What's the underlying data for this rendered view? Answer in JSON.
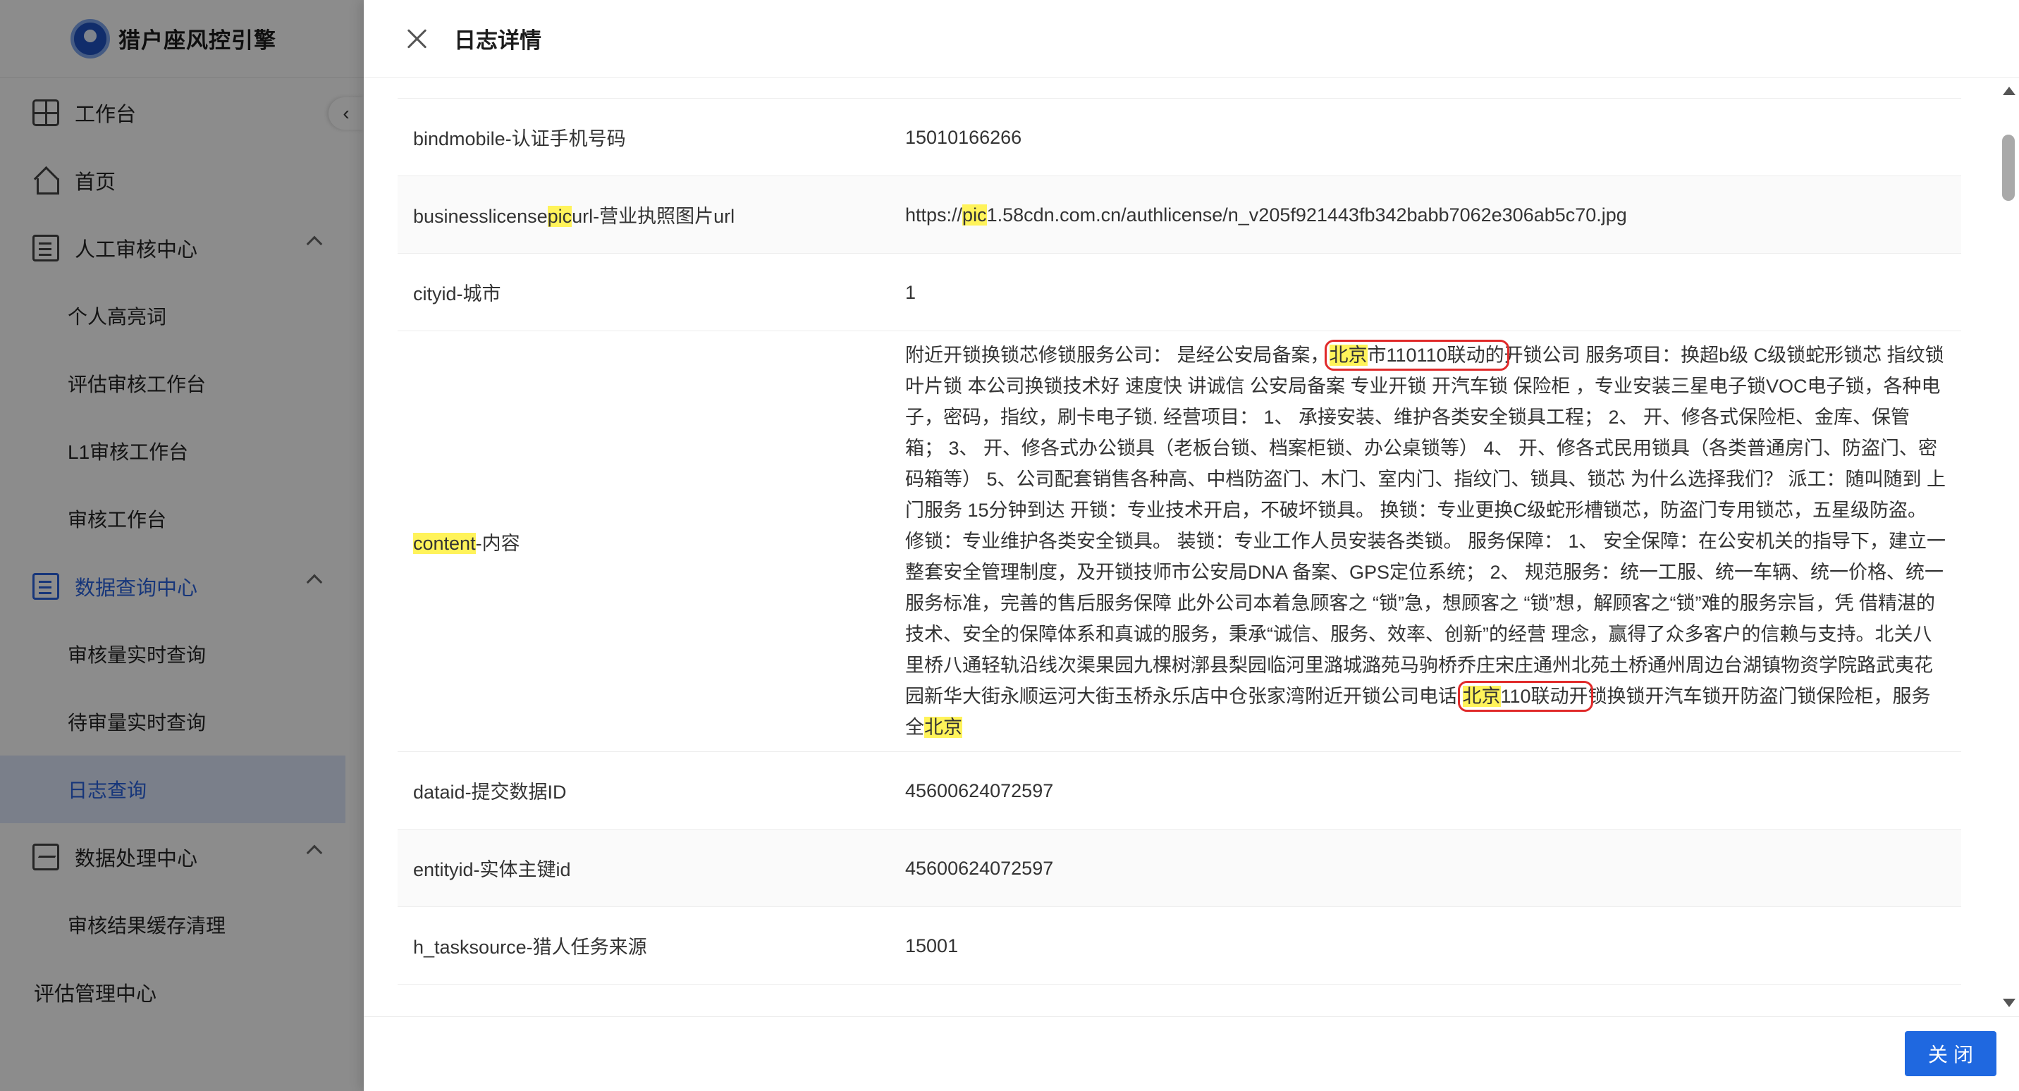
{
  "app": {
    "brand_title": "猎户座风控引擎"
  },
  "sidebar": {
    "collapse_glyph": "‹",
    "items": [
      {
        "label": "工作台",
        "icon": "dashboard-icon"
      },
      {
        "label": "首页",
        "icon": "home-icon"
      },
      {
        "label": "人工审核中心",
        "icon": "review-icon",
        "expanded": true,
        "children": [
          "个人高亮词",
          "评估审核工作台",
          "L1审核工作台",
          "审核工作台"
        ]
      },
      {
        "label": "数据查询中心",
        "icon": "query-icon",
        "expanded": true,
        "children": [
          "审核量实时查询",
          "待审量实时查询",
          "日志查询"
        ],
        "active_child": "日志查询"
      },
      {
        "label": "数据处理中心",
        "icon": "process-icon",
        "expanded": true,
        "children": [
          "审核结果缓存清理"
        ]
      },
      {
        "label": "评估管理中心"
      }
    ]
  },
  "drawer": {
    "title": "日志详情",
    "close_button": "关闭",
    "rows": [
      {
        "key": "bindmobile-认证手机号码",
        "value": "15010166266"
      },
      {
        "key_pre": "businesslicense",
        "key_hl": "pic",
        "key_post": "url-营业执照图片url",
        "val_pre": "https://",
        "val_hl": "pic",
        "val_post": "1.58cdn.com.cn/authlicense/n_v205f921443fb342babb7062e306ab5c70.jpg"
      },
      {
        "key": "cityid-城市",
        "value": "1"
      },
      {
        "key_hl": "content",
        "key_post": "-内容",
        "c1": "附近开锁换锁芯修锁服务公司： 是经公安局备案，",
        "c_hl1": "北京",
        "c2": "市110110联动的",
        "c3": "开锁公司 服务项目：换超b级 C级锁蛇形锁芯 指纹锁 叶片锁 本公司换锁技术好 速度快 讲诚信 公安局备案 专业开锁 开汽车锁 保险柜 ，专业安装三星电子锁VOC电子锁，各种电子，密码，指纹，刷卡电子锁. 经营项目： 1、 承接安装、维护各类安全锁具工程； 2、 开、修各式保险柜、金库、保管箱； 3、 开、修各式办公锁具（老板台锁、档案柜锁、办公桌锁等） 4、 开、修各式民用锁具（各类普通房门、防盗门、密码箱等） 5、公司配套销售各种高、中档防盗门、木门、室内门、指纹门、锁具、锁芯 为什么选择我们？ 派工：随叫随到 上门服务 15分钟到达 开锁：专业技术开启，不破坏锁具。 换锁：专业更换C级蛇形槽锁芯，防盗门专用锁芯，五星级防盗。 修锁：专业维护各类安全锁具。 装锁：专业工作人员安装各类锁。 服务保障： 1、 安全保障：在公安机关的指导下，建立一整套安全管理制度，及开锁技师市公安局DNA 备案、GPS定位系统； 2、 规范服务：统一工服、统一车辆、统一价格、统一服务标准，完善的售后服务保障 此外公司本着急顾客之 “锁”急，想顾客之 “锁”想，解顾客之“锁”难的服务宗旨，凭 借精湛的技术、安全的保障体系和真诚的服务，秉承“诚信、服务、效率、创新”的经营 理念，赢得了众多客户的信赖与支持。北关八里桥八通轻轨沿线次渠果园九棵树漷县梨园临河里潞城潞苑马驹桥乔庄宋庄通州北苑土桥通州周边台湖镇物资学院路武夷花园新华大街永顺运河大街玉桥永乐店中仓张家湾附近开锁公司电话 ",
        "c_hl2": "北京",
        "c4": "110联动开",
        "c5": "锁换锁开汽车锁开防盗门锁保险柜，服务全",
        "c_hl3": "北京"
      },
      {
        "key": "dataid-提交数据ID",
        "value": "45600624072597"
      },
      {
        "key": "entityid-实体主键id",
        "value": "45600624072597"
      },
      {
        "key": "h_tasksource-猎人任务来源",
        "value": "15001"
      }
    ]
  },
  "colors": {
    "primary": "#1f68e0",
    "highlight": "#fff35a",
    "annotation_box": "#e02a2a",
    "active_menu": "#2a63de"
  }
}
